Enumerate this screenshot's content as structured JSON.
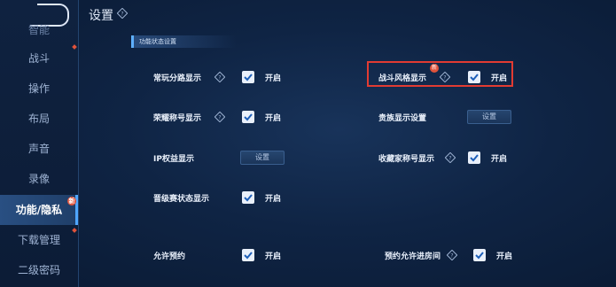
{
  "header": {
    "title": "设置"
  },
  "sidebar": {
    "items": [
      {
        "label": "智能"
      },
      {
        "label": "战斗"
      },
      {
        "label": "操作"
      },
      {
        "label": "布局"
      },
      {
        "label": "声音"
      },
      {
        "label": "录像"
      },
      {
        "label": "功能/隐私",
        "badge": "新"
      },
      {
        "label": "下载管理"
      },
      {
        "label": "二级密码"
      }
    ]
  },
  "section": {
    "title": "功能状态设置"
  },
  "settings": {
    "on_text": "开启",
    "button_text": "设置",
    "common_route": {
      "label": "常玩分路显示",
      "checked": true
    },
    "battle_style": {
      "label": "战斗风格显示",
      "checked": true,
      "badge": "新"
    },
    "honor_title": {
      "label": "荣耀称号显示",
      "checked": true
    },
    "noble": {
      "label": "贵族显示设置"
    },
    "ip_rights": {
      "label": "IP权益显示"
    },
    "collector_title": {
      "label": "收藏家称号显示",
      "checked": true
    },
    "promotion": {
      "label": "晋级赛状态显示",
      "checked": true
    },
    "allow_booking": {
      "label": "允许预约",
      "checked": true
    },
    "booking_join_room": {
      "label": "预约允许进房间",
      "checked": true
    }
  },
  "colors": {
    "highlight": "#e23b32",
    "accent": "#4fa6ff",
    "badge": "#e0533b"
  }
}
